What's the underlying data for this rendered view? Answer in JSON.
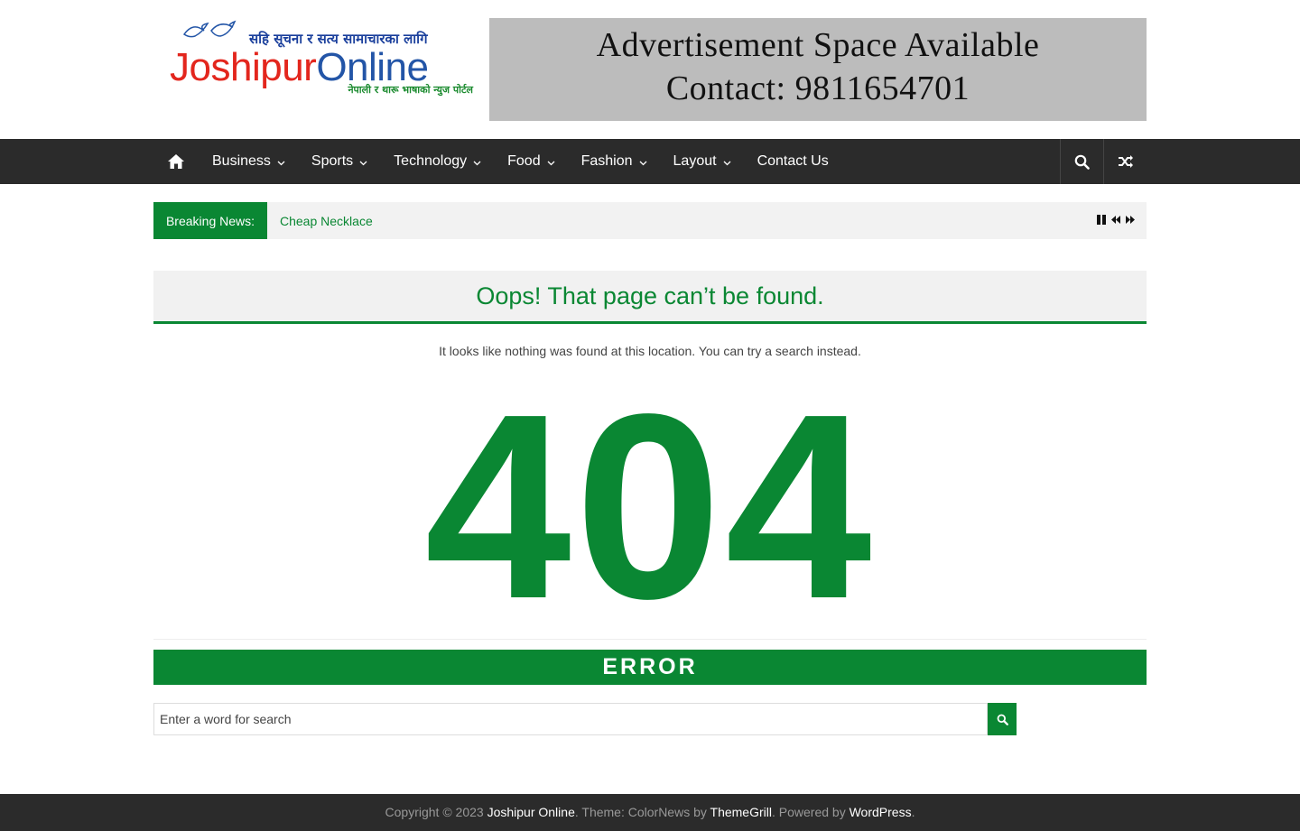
{
  "logo": {
    "tagline_top": "सहि सूचना र सत्य सामाचारका लागि",
    "brand_part1": "Joshipur",
    "brand_part2": "Online",
    "tagline_bottom": "नेपाली र थारू भाषाको न्युज पोर्टल"
  },
  "ad": {
    "line1": "Advertisement Space Available",
    "line2": "Contact: 9811654701"
  },
  "nav": {
    "items": [
      {
        "label": "Business"
      },
      {
        "label": "Sports"
      },
      {
        "label": "Technology"
      },
      {
        "label": "Food"
      },
      {
        "label": "Fashion"
      },
      {
        "label": "Layout"
      },
      {
        "label": "Contact Us"
      }
    ],
    "icons": [
      "home-icon",
      "search-icon",
      "random-icon"
    ]
  },
  "breaking": {
    "label": "Breaking News:",
    "headline": "Cheap Necklace"
  },
  "main": {
    "title": "Oops! That page can’t be found.",
    "message": "It looks like nothing was found at this location. You can try a search instead.",
    "code": "404",
    "error_label": "ERROR"
  },
  "search": {
    "placeholder": "Enter a word for search"
  },
  "footer": {
    "copyright": "Copyright © 2023 ",
    "site": "Joshipur Online",
    "theme_text": ". Theme: ColorNews by ",
    "theme_author": "ThemeGrill",
    "powered_text": ". Powered by ",
    "platform": "WordPress",
    "end": "."
  },
  "colors": {
    "accent": "#0a8733",
    "nav_bg": "#2b2b2b",
    "ad_bg": "#bcbcbc"
  }
}
